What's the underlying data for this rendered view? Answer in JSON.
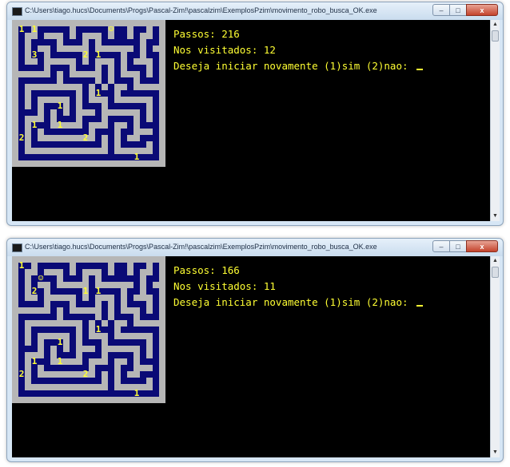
{
  "colors": {
    "wall": "#c0c0c0",
    "path": "#000066",
    "text": "#ffff33",
    "console_bg": "#000000"
  },
  "windows": [
    {
      "title": "C:\\Users\\tiago.hucs\\Documents\\Progs\\Pascal-Zim!\\pascalzim\\ExemplosPzim\\movimento_robo_busca_OK.exe",
      "controls": {
        "minimize": "–",
        "maximize": "□",
        "close": "x"
      },
      "passos_line": "Passos: 216",
      "visitados_line": "Nos visitados: 12",
      "prompt_line": "Deseja iniciar novamente (1)sim (2)nao: ",
      "maze_labels": [
        "1",
        "1",
        "☺",
        "3",
        "2",
        "1",
        "1",
        "1",
        "1",
        "1",
        "2",
        "2",
        "1"
      ]
    },
    {
      "title": "C:\\Users\\tiago.hucs\\Documents\\Progs\\Pascal-Zim!\\pascalzim\\ExemplosPzim\\movimento_robo_busca_OK.exe",
      "controls": {
        "minimize": "–",
        "maximize": "□",
        "close": "x"
      },
      "passos_line": "Passos: 166",
      "visitados_line": "Nos visitados: 11",
      "prompt_line": "Deseja iniciar novamente (1)sim (2)nao: ",
      "maze_labels": [
        "1",
        "☺",
        "2",
        "1",
        "1",
        "1",
        "1",
        "1",
        "1",
        "2",
        "2",
        "1"
      ]
    }
  ]
}
